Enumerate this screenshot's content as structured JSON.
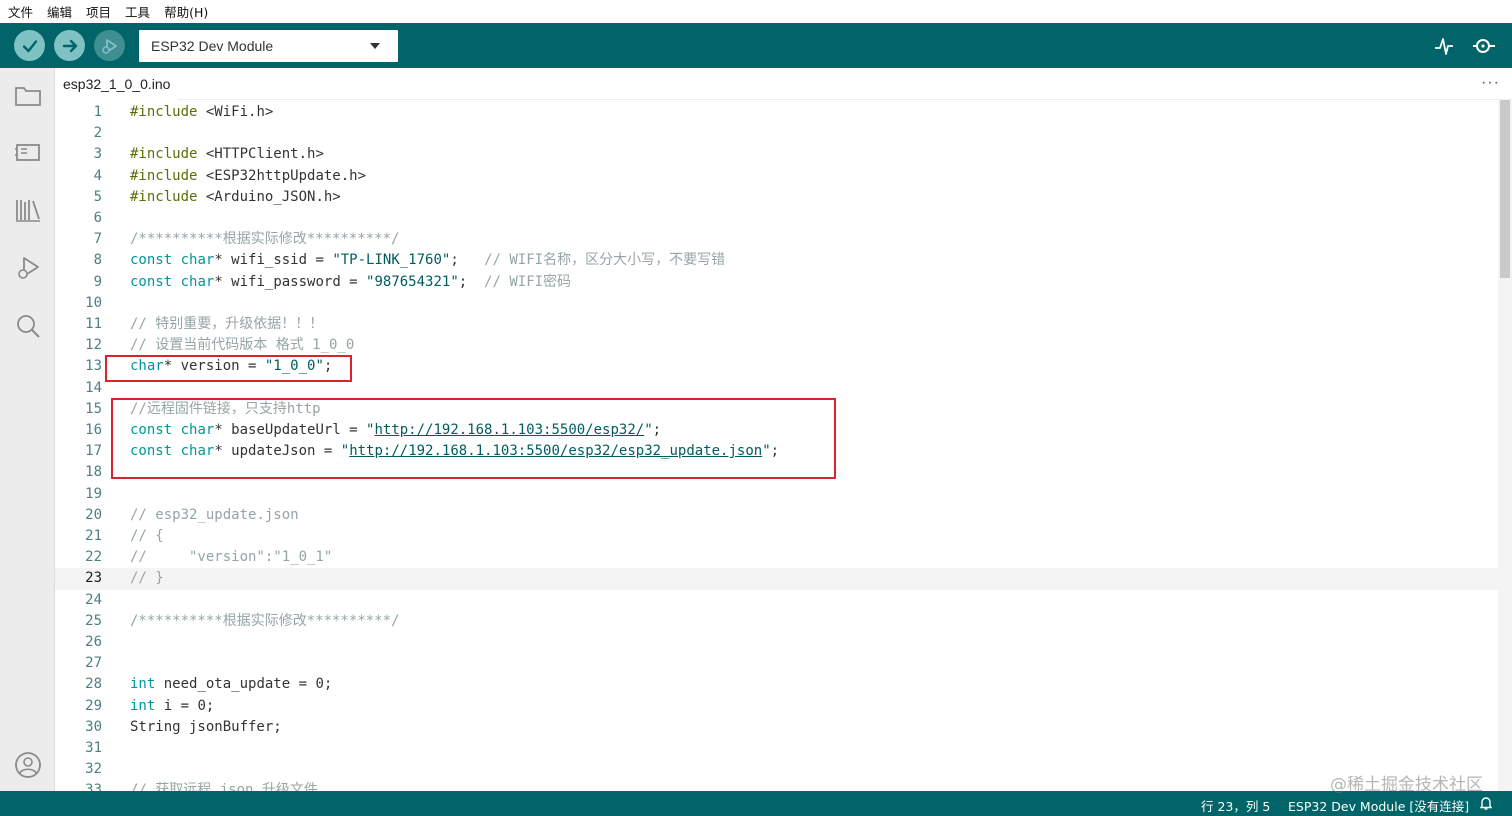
{
  "menu": [
    "文件",
    "编辑",
    "项目",
    "工具",
    "帮助(H)"
  ],
  "toolbar": {
    "board": "ESP32 Dev Module"
  },
  "tab": {
    "filename": "esp32_1_0_0.ino",
    "more": "···"
  },
  "code_lines": [
    {
      "n": "1",
      "parts": [
        [
          "pp",
          "#include"
        ],
        [
          "",
          " <WiFi.h>"
        ]
      ]
    },
    {
      "n": "2",
      "parts": []
    },
    {
      "n": "3",
      "parts": [
        [
          "pp",
          "#include"
        ],
        [
          "",
          " <HTTPClient.h>"
        ]
      ]
    },
    {
      "n": "4",
      "parts": [
        [
          "pp",
          "#include"
        ],
        [
          "",
          " <ESP32httpUpdate.h>"
        ]
      ]
    },
    {
      "n": "5",
      "parts": [
        [
          "pp",
          "#include"
        ],
        [
          "",
          " <Arduino_JSON.h>"
        ]
      ]
    },
    {
      "n": "6",
      "parts": []
    },
    {
      "n": "7",
      "parts": [
        [
          "cm",
          "/**********根据实际修改**********/"
        ]
      ]
    },
    {
      "n": "8",
      "parts": [
        [
          "kw",
          "const"
        ],
        [
          "",
          " "
        ],
        [
          "kw",
          "char"
        ],
        [
          "",
          "* wifi_ssid = "
        ],
        [
          "str",
          "\"TP-LINK_1760\""
        ],
        [
          "",
          ";   "
        ],
        [
          "cm",
          "// WIFI名称，区分大小写，不要写错"
        ]
      ]
    },
    {
      "n": "9",
      "parts": [
        [
          "kw",
          "const"
        ],
        [
          "",
          " "
        ],
        [
          "kw",
          "char"
        ],
        [
          "",
          "* wifi_password = "
        ],
        [
          "str",
          "\"987654321\""
        ],
        [
          "",
          ";  "
        ],
        [
          "cm",
          "// WIFI密码"
        ]
      ]
    },
    {
      "n": "10",
      "parts": []
    },
    {
      "n": "11",
      "parts": [
        [
          "cm",
          "// 特别重要，升级依据！！！"
        ]
      ]
    },
    {
      "n": "12",
      "parts": [
        [
          "cm",
          "// 设置当前代码版本 格式 1_0_0"
        ]
      ]
    },
    {
      "n": "13",
      "parts": [
        [
          "kw",
          "char"
        ],
        [
          "",
          "* version = "
        ],
        [
          "str",
          "\"1_0_0\""
        ],
        [
          "",
          ";"
        ]
      ]
    },
    {
      "n": "14",
      "parts": []
    },
    {
      "n": "15",
      "parts": [
        [
          "cm",
          "//远程固件链接，只支持http"
        ]
      ]
    },
    {
      "n": "16",
      "parts": [
        [
          "kw",
          "const"
        ],
        [
          "",
          " "
        ],
        [
          "kw",
          "char"
        ],
        [
          "",
          "* baseUpdateUrl = "
        ],
        [
          "str",
          "\""
        ],
        [
          "url",
          "http://192.168.1.103:5500/esp32/"
        ],
        [
          "str",
          "\""
        ],
        [
          "",
          ";"
        ]
      ]
    },
    {
      "n": "17",
      "parts": [
        [
          "kw",
          "const"
        ],
        [
          "",
          " "
        ],
        [
          "kw",
          "char"
        ],
        [
          "",
          "* updateJson = "
        ],
        [
          "str",
          "\""
        ],
        [
          "url",
          "http://192.168.1.103:5500/esp32/esp32_update.json"
        ],
        [
          "str",
          "\""
        ],
        [
          "",
          ";"
        ]
      ]
    },
    {
      "n": "18",
      "parts": []
    },
    {
      "n": "19",
      "parts": []
    },
    {
      "n": "20",
      "parts": [
        [
          "cm",
          "// esp32_update.json"
        ]
      ]
    },
    {
      "n": "21",
      "parts": [
        [
          "cm",
          "// {"
        ]
      ]
    },
    {
      "n": "22",
      "parts": [
        [
          "cm",
          "//     \"version\":\"1_0_1\""
        ]
      ]
    },
    {
      "n": "23",
      "parts": [
        [
          "cm",
          "// }"
        ]
      ]
    },
    {
      "n": "24",
      "parts": []
    },
    {
      "n": "25",
      "parts": [
        [
          "cm",
          "/**********根据实际修改**********/"
        ]
      ]
    },
    {
      "n": "26",
      "parts": []
    },
    {
      "n": "27",
      "parts": []
    },
    {
      "n": "28",
      "parts": [
        [
          "kw",
          "int"
        ],
        [
          "",
          " need_ota_update = 0;"
        ]
      ]
    },
    {
      "n": "29",
      "parts": [
        [
          "kw",
          "int"
        ],
        [
          "",
          " i = 0;"
        ]
      ]
    },
    {
      "n": "30",
      "parts": [
        [
          "",
          "String jsonBuffer;"
        ]
      ]
    },
    {
      "n": "31",
      "parts": []
    },
    {
      "n": "32",
      "parts": []
    },
    {
      "n": "33",
      "parts": [
        [
          "cm",
          "// 获取远程 json 升级文件"
        ]
      ]
    }
  ],
  "current_line": "23",
  "status": {
    "position": "行 23，列 5",
    "board": "ESP32 Dev Module [没有连接]"
  },
  "watermark": "@稀土掘金技术社区",
  "colors": {
    "toolbar": "#006468",
    "accent": "#00979c",
    "highlight_box": "#d9232d"
  }
}
